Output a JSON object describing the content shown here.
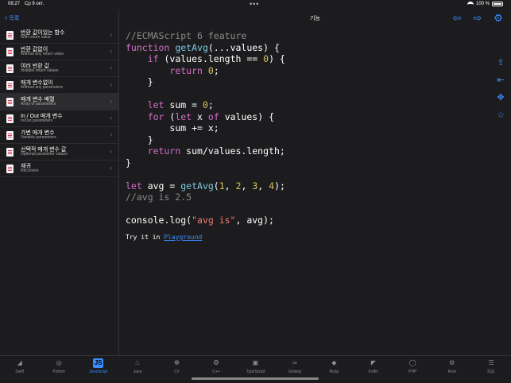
{
  "status": {
    "time": "08:27",
    "date": "Ср 9 окт.",
    "battery": "100 %"
  },
  "sidebar": {
    "back_label": "목록",
    "items": [
      {
        "title": "반환 값이있는 함수",
        "sub": "With return value"
      },
      {
        "title": "반환 값없이",
        "sub": "Without any return value"
      },
      {
        "title": "여러 반환 값",
        "sub": "Multiple return values"
      },
      {
        "title": "매개 변수없이",
        "sub": "Without any parameters"
      },
      {
        "title": "매개 변수 배열",
        "sub": "Array of parameters"
      },
      {
        "title": "In / Out 매개 변수",
        "sub": "In/Out parameters"
      },
      {
        "title": "가변 매개 변수",
        "sub": "Variable parameters"
      },
      {
        "title": "선택적 매개 변수 값",
        "sub": "Optional parameter values"
      },
      {
        "title": "재귀",
        "sub": "Recursion"
      }
    ]
  },
  "header": {
    "title": "기능"
  },
  "code": {
    "l1": "//ECMAScript 6 feature",
    "l2_kw": "function",
    "l2_fn": "getAvg",
    "l2_rest": "(...values) {",
    "l3_kw": "if",
    "l3_a": " (values.length == ",
    "l3_num": "0",
    "l3_b": ") {",
    "l4_kw": "return",
    "l4_num": "0",
    "l4_b": ";",
    "l5": "}",
    "l6_kw": "let",
    "l6_a": " sum = ",
    "l6_num": "0",
    "l6_b": ";",
    "l7_kw": "for",
    "l7_a": " (",
    "l7_kw2": "let",
    "l7_b": " x ",
    "l7_kw3": "of",
    "l7_c": " values) {",
    "l8": "sum += x;",
    "l9": "}",
    "l10_kw": "return",
    "l10_a": " sum/values.length;",
    "l11": "}",
    "l12_kw": "let",
    "l12_a": " avg = ",
    "l12_fn": "getAvg",
    "l12_b": "(",
    "l12_n1": "1",
    "l12_c": ", ",
    "l12_n2": "2",
    "l12_d": ", ",
    "l12_n3": "3",
    "l12_e": ", ",
    "l12_n4": "4",
    "l12_f": ");",
    "l13": "//avg is 2.5",
    "l14_a": "console.log(",
    "l14_str": "\"avg is\"",
    "l14_b": ", avg);",
    "try_text": "Try it in ",
    "try_link": "Playground"
  },
  "tabs": [
    {
      "label": "Swift",
      "icon": "swift-icon"
    },
    {
      "label": "Python",
      "icon": "python-icon"
    },
    {
      "label": "JavaScript",
      "icon": "js-icon"
    },
    {
      "label": "Java",
      "icon": "java-icon"
    },
    {
      "label": "C#",
      "icon": "csharp-icon"
    },
    {
      "label": "C++",
      "icon": "cpp-icon"
    },
    {
      "label": "TypeScript",
      "icon": "typescript-icon"
    },
    {
      "label": "Golang",
      "icon": "golang-icon"
    },
    {
      "label": "Ruby",
      "icon": "ruby-icon"
    },
    {
      "label": "Kotlin",
      "icon": "kotlin-icon"
    },
    {
      "label": "PHP",
      "icon": "php-icon"
    },
    {
      "label": "Rust",
      "icon": "rust-icon"
    },
    {
      "label": "SQL",
      "icon": "sql-icon"
    }
  ],
  "active_tab": "JavaScript",
  "colors": {
    "accent": "#3b8cff",
    "keyword": "#d36ec8",
    "function": "#7cc9e0",
    "number": "#d8c25a",
    "string": "#f07a6a",
    "comment": "#8a8a8a"
  }
}
